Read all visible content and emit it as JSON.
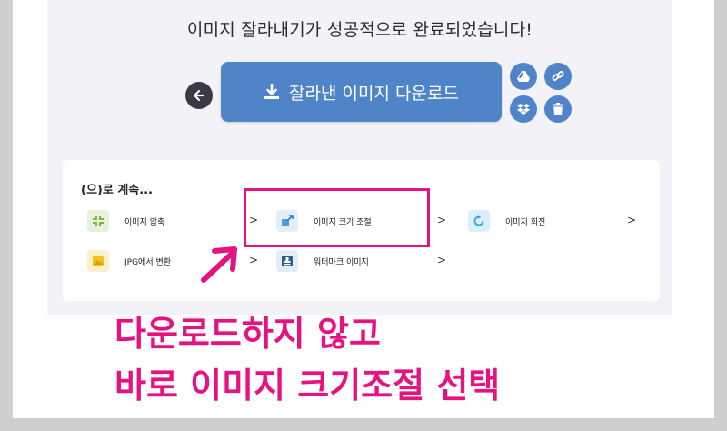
{
  "headline": "이미지 잘라내기가 성공적으로 완료되었습니다!",
  "download_label": "잘라낸 이미지 다운로드",
  "continue_title": "(으)로 계속...",
  "tools": [
    {
      "label": "이미지 압축"
    },
    {
      "label": "이미지 크기 조절"
    },
    {
      "label": "이미지 회전"
    },
    {
      "label": "JPG에서 변환"
    },
    {
      "label": "워터마크 이미지"
    }
  ],
  "chevron": ">",
  "annotation": {
    "line1": "다운로드하지 않고",
    "line2": "바로 이미지 크기조절 선택"
  },
  "colors": {
    "accent_blue": "#4f84c9",
    "highlight_pink": "#e5127f",
    "panel_bg": "#f3f3f7"
  },
  "icons": [
    "arrow-left-icon",
    "download-icon",
    "google-drive-icon",
    "link-icon",
    "dropbox-icon",
    "trash-icon",
    "compress-icon",
    "resize-icon",
    "rotate-icon",
    "jpg-convert-icon",
    "watermark-icon"
  ]
}
